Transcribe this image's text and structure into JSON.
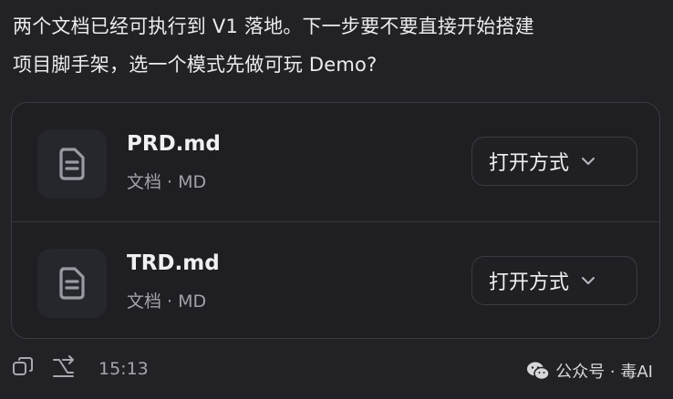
{
  "message": {
    "line1": "两个文档已经可执行到 V1 落地。下一步要不要直接开始搭建",
    "line2": "项目脚手架，选一个模式先做可玩 Demo?"
  },
  "files": [
    {
      "name": "PRD.md",
      "meta": "文档 · MD",
      "icon": "document-icon",
      "open_label": "打开方式"
    },
    {
      "name": "TRD.md",
      "meta": "文档 · MD",
      "icon": "document-icon",
      "open_label": "打开方式"
    }
  ],
  "toolbar": {
    "copy_icon": "copy-icon",
    "branch_icon": "branch-icon",
    "timestamp": "15:13"
  },
  "watermark": {
    "text": "公众号 · 毒AI",
    "icon": "wechat-icon"
  },
  "colors": {
    "background": "#222226",
    "card_border": "#3a3a40",
    "text_primary": "#ececef",
    "text_secondary": "#a1a1a8"
  }
}
